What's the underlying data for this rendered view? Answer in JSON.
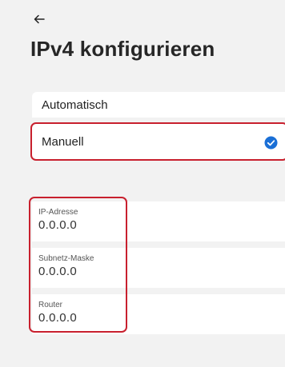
{
  "header": {
    "back_icon": "arrow-left-icon",
    "title": "IPv4 konfigurieren"
  },
  "mode_options": [
    {
      "label": "Automatisch",
      "selected": false
    },
    {
      "label": "Manuell",
      "selected": true
    }
  ],
  "selected_check_icon": "check-circle-icon",
  "fields": {
    "ip": {
      "label": "IP-Adresse",
      "value": "0.0.0.0"
    },
    "subnet": {
      "label": "Subnetz-Maske",
      "value": "0.0.0.0"
    },
    "router": {
      "label": "Router",
      "value": "0.0.0.0"
    }
  },
  "colors": {
    "accent": "#1a6fd6",
    "highlight": "#c8202e",
    "background": "#f2f2f2"
  }
}
